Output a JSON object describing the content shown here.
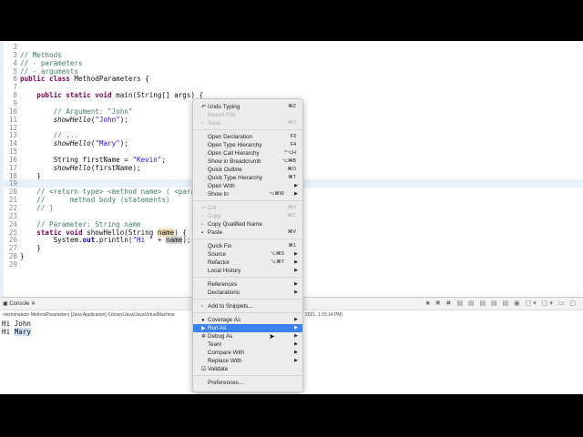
{
  "editor": {
    "lines": [
      {
        "n": "2",
        "s": []
      },
      {
        "n": "3",
        "s": [
          [
            "// Methods",
            "cm"
          ]
        ]
      },
      {
        "n": "4",
        "s": [
          [
            "// - parameters",
            "cm"
          ]
        ]
      },
      {
        "n": "5",
        "s": [
          [
            "// - arguments",
            "cm"
          ]
        ]
      },
      {
        "n": "6",
        "s": [
          [
            "public class ",
            "kw"
          ],
          [
            "MethodParameters {",
            ""
          ]
        ]
      },
      {
        "n": "7",
        "s": []
      },
      {
        "n": "8",
        "s": [
          [
            "    public static void ",
            "kw"
          ],
          [
            "main(String[] args) {",
            ""
          ]
        ]
      },
      {
        "n": "9",
        "s": []
      },
      {
        "n": "10",
        "s": [
          [
            "        // Argument: \"John\"",
            "cm"
          ]
        ]
      },
      {
        "n": "11",
        "s": [
          [
            "        ",
            ""
          ],
          [
            "showHello",
            "it"
          ],
          [
            "(",
            ""
          ],
          [
            "\"John\"",
            "st"
          ],
          [
            ");",
            ""
          ]
        ]
      },
      {
        "n": "12",
        "s": []
      },
      {
        "n": "13",
        "s": [
          [
            "        // ...",
            "cm"
          ]
        ]
      },
      {
        "n": "14",
        "s": [
          [
            "        ",
            ""
          ],
          [
            "showHello",
            "it"
          ],
          [
            "(",
            ""
          ],
          [
            "\"Mary\"",
            "st"
          ],
          [
            ");",
            ""
          ]
        ]
      },
      {
        "n": "15",
        "s": []
      },
      {
        "n": "16",
        "s": [
          [
            "        String firstName = ",
            ""
          ],
          [
            "\"Kevin\"",
            "st"
          ],
          [
            ";",
            ""
          ]
        ]
      },
      {
        "n": "17",
        "s": [
          [
            "        ",
            ""
          ],
          [
            "showHello",
            "it"
          ],
          [
            "(firstName);",
            ""
          ]
        ]
      },
      {
        "n": "18",
        "s": [
          [
            "    }",
            ""
          ]
        ]
      },
      {
        "n": "19",
        "s": [],
        "current": true
      },
      {
        "n": "20",
        "s": [
          [
            "    // <return type> <method name> ( <para",
            "cm"
          ]
        ]
      },
      {
        "n": "21",
        "s": [
          [
            "    //      method body (statements)",
            "cm"
          ]
        ]
      },
      {
        "n": "22",
        "s": [
          [
            "    // }",
            "cm"
          ]
        ]
      },
      {
        "n": "23",
        "s": []
      },
      {
        "n": "24",
        "s": [
          [
            "    // Parameter: String name",
            "cm"
          ]
        ]
      },
      {
        "n": "25",
        "s": [
          [
            "    static void ",
            "kw"
          ],
          [
            "showHello(String ",
            ""
          ],
          [
            "name",
            "hl"
          ],
          [
            ") {",
            ""
          ]
        ]
      },
      {
        "n": "26",
        "s": [
          [
            "        System.",
            ""
          ],
          [
            "out",
            "fld"
          ],
          [
            ".println(",
            ""
          ],
          [
            "\"Hi \"",
            "st"
          ],
          [
            " + ",
            ""
          ],
          [
            "name",
            "hl2"
          ],
          [
            ");",
            ""
          ]
        ]
      },
      {
        "n": "27",
        "s": [
          [
            "    }",
            ""
          ]
        ]
      },
      {
        "n": "28",
        "s": [
          [
            "}",
            ""
          ]
        ]
      },
      {
        "n": "29",
        "s": []
      }
    ]
  },
  "console": {
    "tab": "Console",
    "status_left": "<terminated> MethodParameters [Java Application] /Library/Java/JavaVirtualMachine",
    "status_right": "2021, 1:15:14 PM)",
    "out1": "Hi John",
    "out2_a": "Hi ",
    "out2_b": "Mary"
  },
  "menu": [
    {
      "label": "Undo Typing",
      "sc": "⌘Z",
      "icon": "↶"
    },
    {
      "label": "Revert File",
      "dis": true
    },
    {
      "label": "Save",
      "sc": "⌘S",
      "dis": true,
      "icon": "▫"
    },
    {
      "sep": true
    },
    {
      "label": "Open Declaration",
      "sc": "F3"
    },
    {
      "label": "Open Type Hierarchy",
      "sc": "F4"
    },
    {
      "label": "Open Call Hierarchy",
      "sc": "^⌥H"
    },
    {
      "label": "Show in Breadcrumb",
      "sc": "⌥⌘B"
    },
    {
      "label": "Quick Outline",
      "sc": "⌘O"
    },
    {
      "label": "Quick Type Hierarchy",
      "sc": "⌘T"
    },
    {
      "label": "Open With",
      "sub": true
    },
    {
      "label": "Show In",
      "sc": "⌥⌘W",
      "sub": true
    },
    {
      "sep": true
    },
    {
      "label": "Cut",
      "sc": "⌘X",
      "dis": true,
      "icon": "✂"
    },
    {
      "label": "Copy",
      "sc": "⌘C",
      "dis": true,
      "icon": "▫"
    },
    {
      "label": "Copy Qualified Name",
      "icon": "▫"
    },
    {
      "label": "Paste",
      "sc": "⌘V",
      "icon": "▪"
    },
    {
      "sep": true
    },
    {
      "label": "Quick Fix",
      "sc": "⌘1"
    },
    {
      "label": "Source",
      "sc": "⌥⌘S",
      "sub": true
    },
    {
      "label": "Refactor",
      "sc": "⌥⌘T",
      "sub": true
    },
    {
      "label": "Local History",
      "sub": true
    },
    {
      "sep": true
    },
    {
      "label": "References",
      "sub": true
    },
    {
      "label": "Declarations",
      "sub": true
    },
    {
      "sep": true
    },
    {
      "label": "Add to Snippets...",
      "icon": "▫"
    },
    {
      "sep": true
    },
    {
      "label": "Coverage As",
      "sub": true,
      "icon": "●"
    },
    {
      "label": "Run As",
      "sub": true,
      "icon": "▶",
      "active": true
    },
    {
      "label": "Debug As",
      "sub": true,
      "icon": "✲"
    },
    {
      "label": "Team",
      "sub": true
    },
    {
      "label": "Compare With",
      "sub": true
    },
    {
      "label": "Replace With",
      "sub": true
    },
    {
      "label": "Validate",
      "icon": "☑"
    },
    {
      "sep": true
    },
    {
      "label": "Preferences..."
    }
  ]
}
